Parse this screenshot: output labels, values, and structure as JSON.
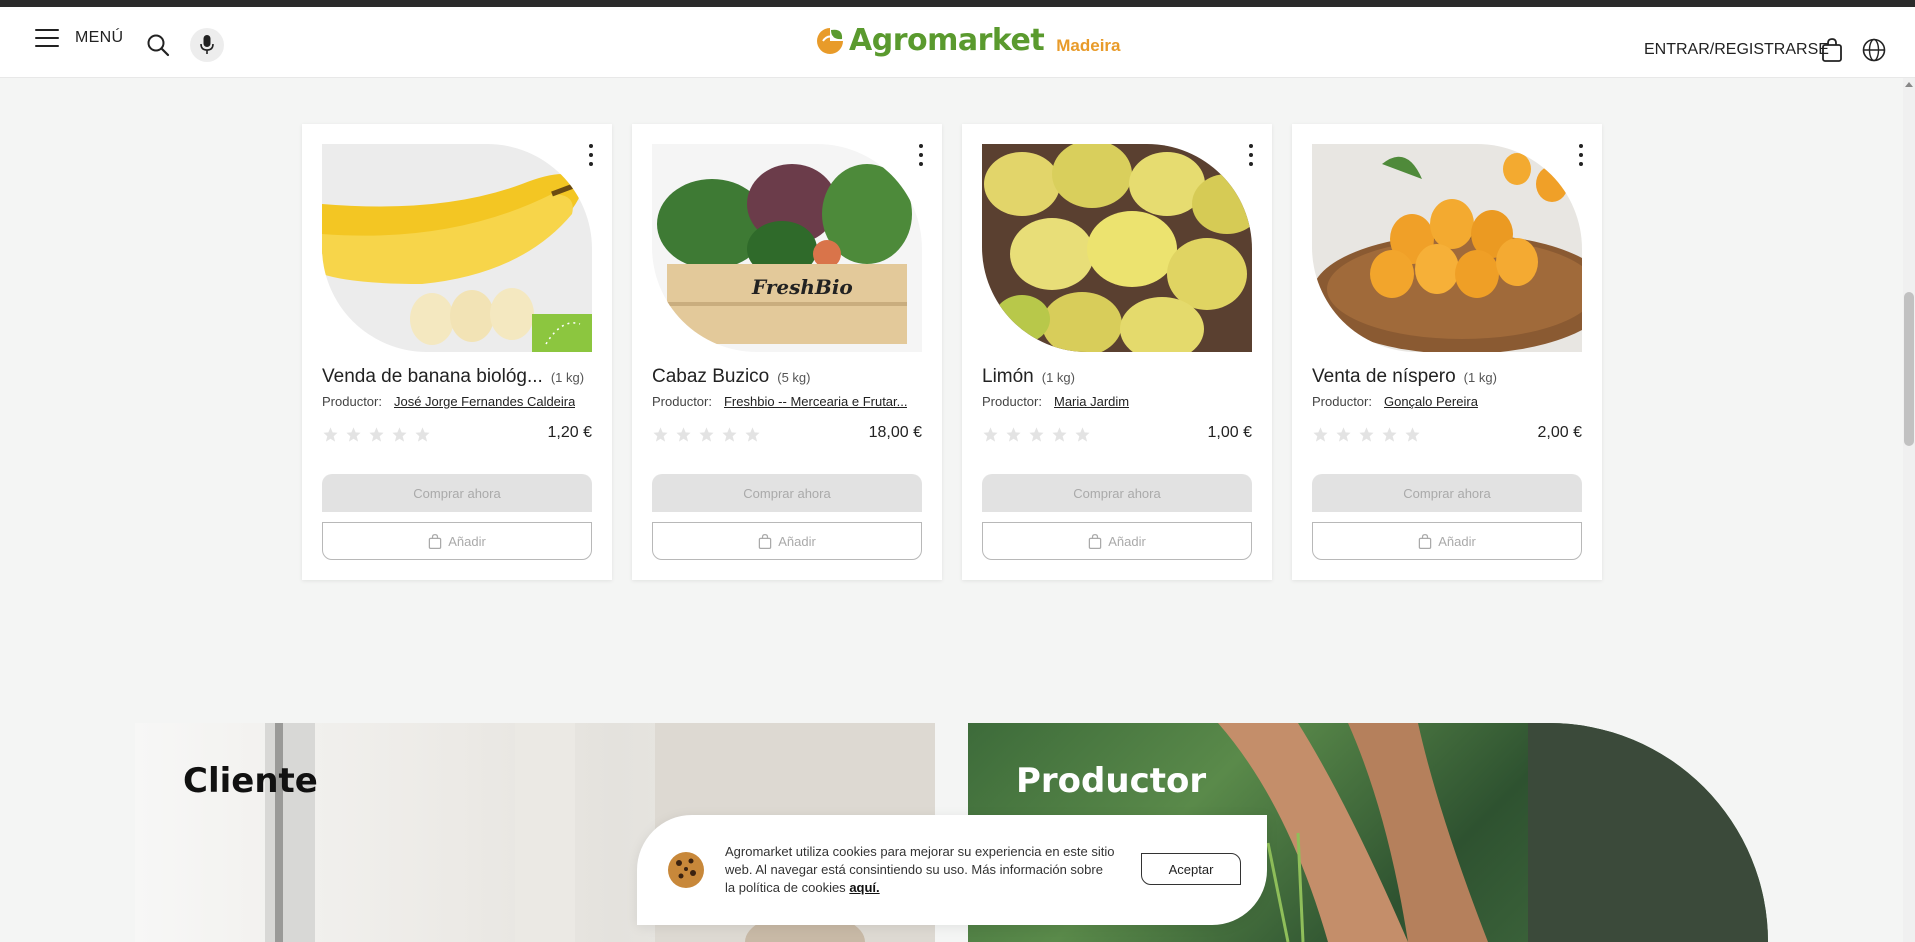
{
  "header": {
    "menu_label": "MENÚ",
    "logo_text": "Agromarket",
    "logo_region": "Madeira",
    "login_label": "ENTRAR/REGISTRARSE"
  },
  "products": [
    {
      "title": "Venda de banana biológ...",
      "weight": "(1 kg)",
      "producer_label": "Productor:",
      "producer": "José Jorge Fernandes Caldeira",
      "price": "1,20 €",
      "rating": 0,
      "buy_label": "Comprar ahora",
      "add_label": "Añadir",
      "organic": true
    },
    {
      "title": "Cabaz Buzico",
      "weight": "(5 kg)",
      "producer_label": "Productor:",
      "producer": "Freshbio -- Mercearia e Frutar...",
      "price": "18,00 €",
      "rating": 0,
      "buy_label": "Comprar ahora",
      "add_label": "Añadir",
      "organic": false
    },
    {
      "title": "Limón",
      "weight": "(1 kg)",
      "producer_label": "Productor:",
      "producer": "Maria Jardim",
      "price": "1,00 €",
      "rating": 0,
      "buy_label": "Comprar ahora",
      "add_label": "Añadir",
      "organic": false
    },
    {
      "title": "Venta de níspero",
      "weight": "(1 kg)",
      "producer_label": "Productor:",
      "producer": "Gonçalo Pereira",
      "price": "2,00 €",
      "rating": 0,
      "buy_label": "Comprar ahora",
      "add_label": "Añadir",
      "organic": false
    }
  ],
  "banners": {
    "client_title": "Cliente",
    "producer_title": "Productor"
  },
  "cookie": {
    "text": "Agromarket utiliza cookies para mejorar su experiencia en este sitio web. Al navegar está consintiendo su uso. Más información sobre la política de cookies",
    "link_label": "aquí.",
    "accept_label": "Aceptar"
  },
  "colors": {
    "brand_green": "#5a9a2e",
    "brand_orange": "#e89b2a",
    "organic_badge": "#8cc63f"
  }
}
